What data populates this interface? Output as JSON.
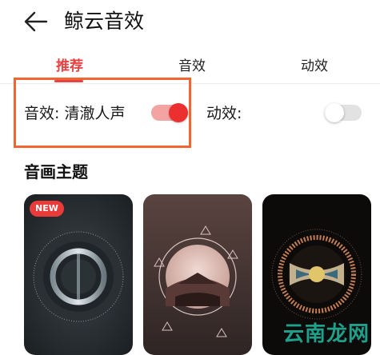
{
  "header": {
    "title": "鲸云音效",
    "back_icon": "arrow-left-icon"
  },
  "tabs": [
    {
      "label": "推荐",
      "active": true
    },
    {
      "label": "音效",
      "active": false
    },
    {
      "label": "动效",
      "active": false
    }
  ],
  "settings": {
    "sound": {
      "label": "音效: 清澈人声",
      "enabled": true
    },
    "motion": {
      "label": "动效:",
      "enabled": false
    }
  },
  "section": {
    "title": "音画主题"
  },
  "cards": [
    {
      "badge": "NEW",
      "theme": "ring-grey"
    },
    {
      "badge": "",
      "theme": "pagoda-circle"
    },
    {
      "badge": "",
      "theme": "mandala-dark"
    }
  ],
  "watermark": {
    "text": "云南龙网"
  },
  "colors": {
    "accent": "#e94242",
    "highlight_box": "#f26430",
    "toggle_on_knob": "#ec2f2f",
    "toggle_on_track": "#f4a3a3",
    "toggle_off_track": "#e2e2e2"
  }
}
